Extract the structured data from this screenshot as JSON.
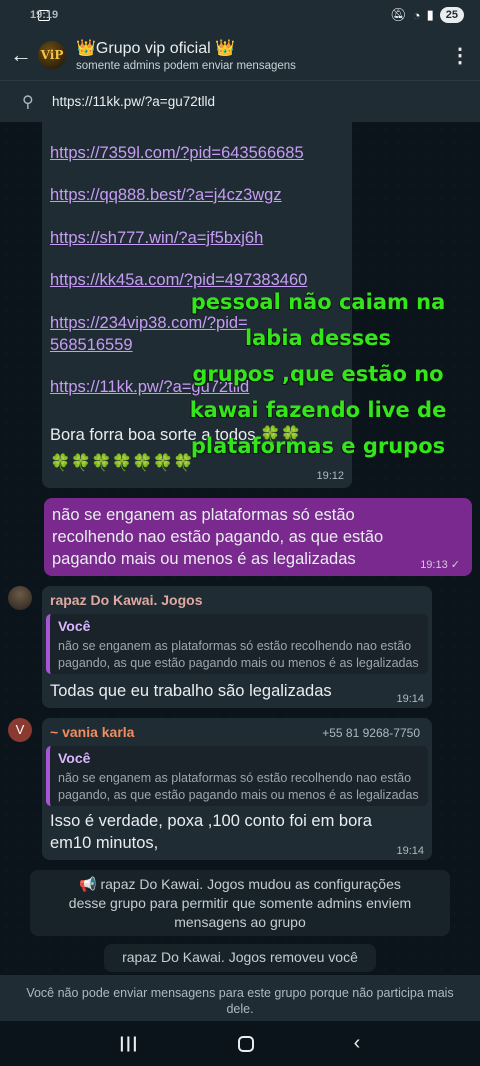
{
  "status_bar": {
    "time": "19:19",
    "battery": "25"
  },
  "header": {
    "title": "👑Grupo vip oficial 👑",
    "subtitle": "somente admins podem enviar mensagens",
    "avatar_text": "ViP"
  },
  "pinned": {
    "text": "https://11kk.pw/?a=gu72tlld"
  },
  "link_message": {
    "links": [
      "https://7359l.com/?pid=643566685",
      "https://qq888.best/?a=j4cz3wgz",
      "https://sh777.win/?a=jf5bxj6h",
      "https://kk45a.com/?pid=497383460",
      "https://234vip38.com/?pid=",
      "568516559",
      "https://11kk.pw/?a=gu72tlld"
    ],
    "text": "Bora forra boa sorte a todos 🍀🍀",
    "clovers": "🍀🍀🍀🍀🍀🍀🍀",
    "time": "19:12"
  },
  "overlay_text": {
    "lines": [
      "pessoal não caiam na",
      "labia desses",
      "grupos ,que estão no",
      "kawai fazendo live de",
      "plataformas e grupos"
    ]
  },
  "my_message": {
    "lines": [
      "não se enganem as plataformas só estão",
      "recolhendo nao estão pagando, as que estão",
      "pagando mais ou menos é as legalizadas"
    ],
    "time": "19:13 ✓"
  },
  "reply1": {
    "sender": "rapaz Do Kawai. Jogos",
    "quote_name": "Você",
    "quote_lines": [
      "não se enganem as plataformas só estão recolhendo nao estão",
      "pagando, as que estão pagando mais ou menos é as legalizadas"
    ],
    "text": "Todas que eu trabalho são legalizadas",
    "time": "19:14"
  },
  "reply2": {
    "avatar_letter": "V",
    "sender": "~ vania karla",
    "phone": "+55 81 9268-7750",
    "quote_name": "Você",
    "quote_lines": [
      "não se enganem as plataformas só estão recolhendo nao estão",
      "pagando, as que estão pagando mais ou menos é as legalizadas"
    ],
    "text_lines": [
      "Isso  é verdade,  poxa ,100 conto foi em bora",
      "em10 minutos,"
    ],
    "time": "19:14"
  },
  "system_messages": {
    "settings_lines": [
      "📢 rapaz Do Kawai. Jogos mudou as configurações",
      "desse grupo para permitir que somente admins enviem",
      "mensagens ao grupo"
    ],
    "removed": "rapaz Do Kawai. Jogos removeu você"
  },
  "footer": {
    "notice": "Você não pode enviar mensagens para este grupo porque não participa mais dele."
  },
  "colors": {
    "outgoing_bubble": "#7a2a8f",
    "incoming_bubble": "#202c33",
    "link": "#c79cf5",
    "overlay_text": "#33e61c",
    "sender1": "#e0a9a0",
    "sender2": "#f28c5e"
  }
}
